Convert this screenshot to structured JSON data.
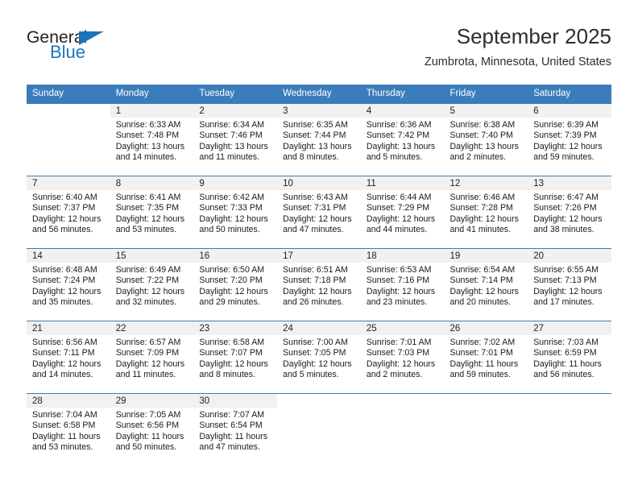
{
  "brand": {
    "name_dark": "General",
    "name_blue": "Blue",
    "accent_color": "#1b75bb"
  },
  "header": {
    "title": "September 2025",
    "subtitle": "Zumbrota, Minnesota, United States"
  },
  "theme": {
    "header_bg": "#3b7cbb",
    "header_text": "#ffffff",
    "daynum_bg": "#f1f1f1",
    "row_divider": "#3b7cbb",
    "body_text": "#1a1a1a"
  },
  "weekdays": [
    "Sunday",
    "Monday",
    "Tuesday",
    "Wednesday",
    "Thursday",
    "Friday",
    "Saturday"
  ],
  "labels": {
    "sunrise_prefix": "Sunrise:",
    "sunset_prefix": "Sunset:",
    "daylight_prefix": "Daylight:"
  },
  "weeks": [
    [
      {
        "day": "",
        "empty": true
      },
      {
        "day": "1",
        "sunrise": "Sunrise: 6:33 AM",
        "sunset": "Sunset: 7:48 PM",
        "daylight_line1": "Daylight: 13 hours",
        "daylight_line2": "and 14 minutes."
      },
      {
        "day": "2",
        "sunrise": "Sunrise: 6:34 AM",
        "sunset": "Sunset: 7:46 PM",
        "daylight_line1": "Daylight: 13 hours",
        "daylight_line2": "and 11 minutes."
      },
      {
        "day": "3",
        "sunrise": "Sunrise: 6:35 AM",
        "sunset": "Sunset: 7:44 PM",
        "daylight_line1": "Daylight: 13 hours",
        "daylight_line2": "and 8 minutes."
      },
      {
        "day": "4",
        "sunrise": "Sunrise: 6:36 AM",
        "sunset": "Sunset: 7:42 PM",
        "daylight_line1": "Daylight: 13 hours",
        "daylight_line2": "and 5 minutes."
      },
      {
        "day": "5",
        "sunrise": "Sunrise: 6:38 AM",
        "sunset": "Sunset: 7:40 PM",
        "daylight_line1": "Daylight: 13 hours",
        "daylight_line2": "and 2 minutes."
      },
      {
        "day": "6",
        "sunrise": "Sunrise: 6:39 AM",
        "sunset": "Sunset: 7:39 PM",
        "daylight_line1": "Daylight: 12 hours",
        "daylight_line2": "and 59 minutes."
      }
    ],
    [
      {
        "day": "7",
        "sunrise": "Sunrise: 6:40 AM",
        "sunset": "Sunset: 7:37 PM",
        "daylight_line1": "Daylight: 12 hours",
        "daylight_line2": "and 56 minutes."
      },
      {
        "day": "8",
        "sunrise": "Sunrise: 6:41 AM",
        "sunset": "Sunset: 7:35 PM",
        "daylight_line1": "Daylight: 12 hours",
        "daylight_line2": "and 53 minutes."
      },
      {
        "day": "9",
        "sunrise": "Sunrise: 6:42 AM",
        "sunset": "Sunset: 7:33 PM",
        "daylight_line1": "Daylight: 12 hours",
        "daylight_line2": "and 50 minutes."
      },
      {
        "day": "10",
        "sunrise": "Sunrise: 6:43 AM",
        "sunset": "Sunset: 7:31 PM",
        "daylight_line1": "Daylight: 12 hours",
        "daylight_line2": "and 47 minutes."
      },
      {
        "day": "11",
        "sunrise": "Sunrise: 6:44 AM",
        "sunset": "Sunset: 7:29 PM",
        "daylight_line1": "Daylight: 12 hours",
        "daylight_line2": "and 44 minutes."
      },
      {
        "day": "12",
        "sunrise": "Sunrise: 6:46 AM",
        "sunset": "Sunset: 7:28 PM",
        "daylight_line1": "Daylight: 12 hours",
        "daylight_line2": "and 41 minutes."
      },
      {
        "day": "13",
        "sunrise": "Sunrise: 6:47 AM",
        "sunset": "Sunset: 7:26 PM",
        "daylight_line1": "Daylight: 12 hours",
        "daylight_line2": "and 38 minutes."
      }
    ],
    [
      {
        "day": "14",
        "sunrise": "Sunrise: 6:48 AM",
        "sunset": "Sunset: 7:24 PM",
        "daylight_line1": "Daylight: 12 hours",
        "daylight_line2": "and 35 minutes."
      },
      {
        "day": "15",
        "sunrise": "Sunrise: 6:49 AM",
        "sunset": "Sunset: 7:22 PM",
        "daylight_line1": "Daylight: 12 hours",
        "daylight_line2": "and 32 minutes."
      },
      {
        "day": "16",
        "sunrise": "Sunrise: 6:50 AM",
        "sunset": "Sunset: 7:20 PM",
        "daylight_line1": "Daylight: 12 hours",
        "daylight_line2": "and 29 minutes."
      },
      {
        "day": "17",
        "sunrise": "Sunrise: 6:51 AM",
        "sunset": "Sunset: 7:18 PM",
        "daylight_line1": "Daylight: 12 hours",
        "daylight_line2": "and 26 minutes."
      },
      {
        "day": "18",
        "sunrise": "Sunrise: 6:53 AM",
        "sunset": "Sunset: 7:16 PM",
        "daylight_line1": "Daylight: 12 hours",
        "daylight_line2": "and 23 minutes."
      },
      {
        "day": "19",
        "sunrise": "Sunrise: 6:54 AM",
        "sunset": "Sunset: 7:14 PM",
        "daylight_line1": "Daylight: 12 hours",
        "daylight_line2": "and 20 minutes."
      },
      {
        "day": "20",
        "sunrise": "Sunrise: 6:55 AM",
        "sunset": "Sunset: 7:13 PM",
        "daylight_line1": "Daylight: 12 hours",
        "daylight_line2": "and 17 minutes."
      }
    ],
    [
      {
        "day": "21",
        "sunrise": "Sunrise: 6:56 AM",
        "sunset": "Sunset: 7:11 PM",
        "daylight_line1": "Daylight: 12 hours",
        "daylight_line2": "and 14 minutes."
      },
      {
        "day": "22",
        "sunrise": "Sunrise: 6:57 AM",
        "sunset": "Sunset: 7:09 PM",
        "daylight_line1": "Daylight: 12 hours",
        "daylight_line2": "and 11 minutes."
      },
      {
        "day": "23",
        "sunrise": "Sunrise: 6:58 AM",
        "sunset": "Sunset: 7:07 PM",
        "daylight_line1": "Daylight: 12 hours",
        "daylight_line2": "and 8 minutes."
      },
      {
        "day": "24",
        "sunrise": "Sunrise: 7:00 AM",
        "sunset": "Sunset: 7:05 PM",
        "daylight_line1": "Daylight: 12 hours",
        "daylight_line2": "and 5 minutes."
      },
      {
        "day": "25",
        "sunrise": "Sunrise: 7:01 AM",
        "sunset": "Sunset: 7:03 PM",
        "daylight_line1": "Daylight: 12 hours",
        "daylight_line2": "and 2 minutes."
      },
      {
        "day": "26",
        "sunrise": "Sunrise: 7:02 AM",
        "sunset": "Sunset: 7:01 PM",
        "daylight_line1": "Daylight: 11 hours",
        "daylight_line2": "and 59 minutes."
      },
      {
        "day": "27",
        "sunrise": "Sunrise: 7:03 AM",
        "sunset": "Sunset: 6:59 PM",
        "daylight_line1": "Daylight: 11 hours",
        "daylight_line2": "and 56 minutes."
      }
    ],
    [
      {
        "day": "28",
        "sunrise": "Sunrise: 7:04 AM",
        "sunset": "Sunset: 6:58 PM",
        "daylight_line1": "Daylight: 11 hours",
        "daylight_line2": "and 53 minutes."
      },
      {
        "day": "29",
        "sunrise": "Sunrise: 7:05 AM",
        "sunset": "Sunset: 6:56 PM",
        "daylight_line1": "Daylight: 11 hours",
        "daylight_line2": "and 50 minutes."
      },
      {
        "day": "30",
        "sunrise": "Sunrise: 7:07 AM",
        "sunset": "Sunset: 6:54 PM",
        "daylight_line1": "Daylight: 11 hours",
        "daylight_line2": "and 47 minutes."
      },
      {
        "day": "",
        "empty": true
      },
      {
        "day": "",
        "empty": true
      },
      {
        "day": "",
        "empty": true
      },
      {
        "day": "",
        "empty": true
      }
    ]
  ]
}
